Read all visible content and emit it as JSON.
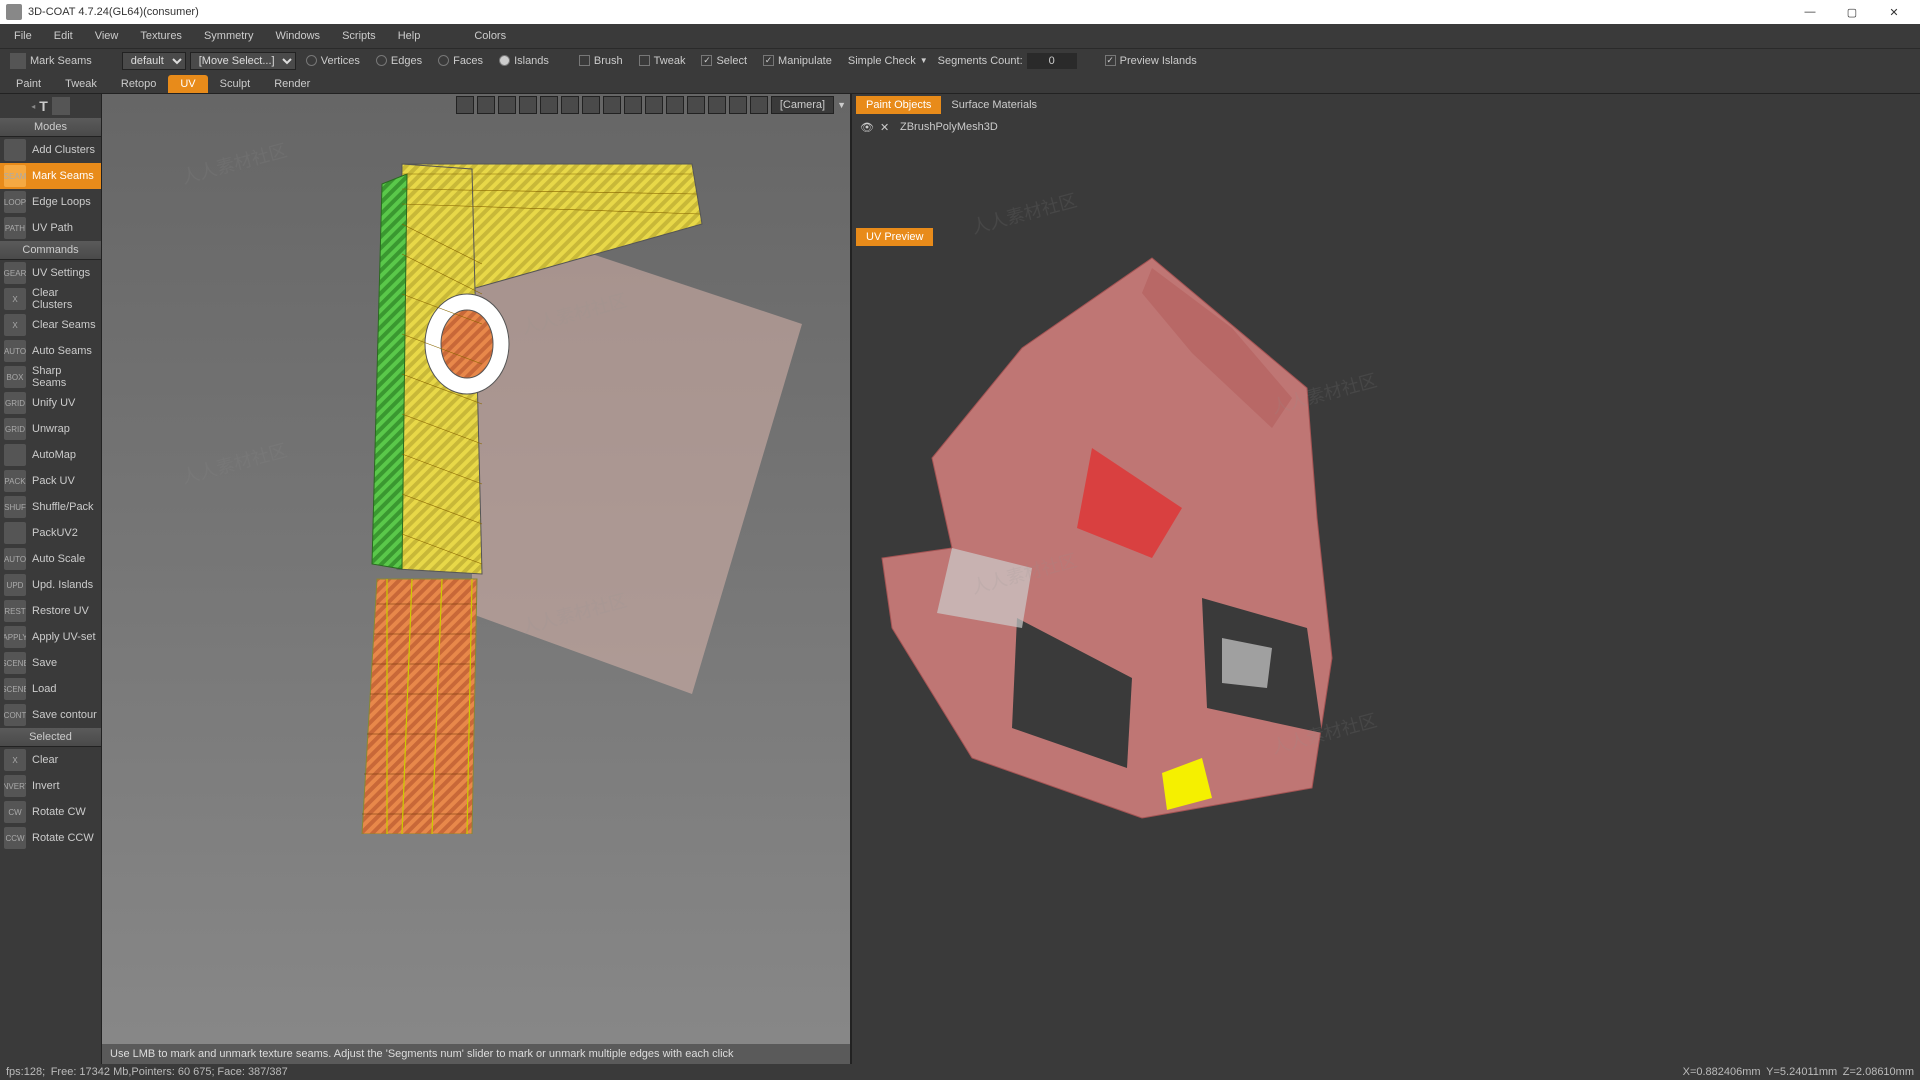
{
  "title": "3D-COAT 4.7.24(GL64)(consumer)",
  "mainmenu": [
    "File",
    "Edit",
    "View",
    "Textures",
    "Symmetry",
    "Windows",
    "Scripts",
    "Help",
    "Colors"
  ],
  "options": {
    "mark_seams": "Mark Seams",
    "preset_label": "default",
    "move_select": "[Move Select...]",
    "el_vertices": "Vertices",
    "el_edges": "Edges",
    "el_faces": "Faces",
    "el_islands": "Islands",
    "brush": "Brush",
    "tweak": "Tweak",
    "select": "Select",
    "manipulate": "Manipulate",
    "simple_check": "Simple Check",
    "segments_label": "Segments Count:",
    "segments_value": "0",
    "preview_islands": "Preview Islands"
  },
  "tabs": [
    "Paint",
    "Tweak",
    "Retopo",
    "UV",
    "Sculpt",
    "Render"
  ],
  "active_tab": "UV",
  "sidebar": {
    "modes_hdr": "Modes",
    "modes": [
      {
        "label": "Add Clusters",
        "ic": "cluster"
      },
      {
        "label": "Mark Seams",
        "ic": "seam",
        "active": true
      },
      {
        "label": "Edge Loops",
        "ic": "loop"
      },
      {
        "label": "UV Path",
        "ic": "path"
      }
    ],
    "commands_hdr": "Commands",
    "commands": [
      {
        "label": "UV Settings",
        "ic": "gear"
      },
      {
        "label": "Clear Clusters",
        "ic": "x"
      },
      {
        "label": "Clear Seams",
        "ic": "x"
      },
      {
        "label": "Auto Seams",
        "ic": "AUTO"
      },
      {
        "label": "Sharp Seams",
        "ic": "box"
      },
      {
        "label": "Unify UV",
        "ic": "grid"
      },
      {
        "label": "Unwrap",
        "ic": "grid"
      },
      {
        "label": "AutoMap",
        "ic": "AUTO MAP"
      },
      {
        "label": "Pack UV",
        "ic": "pack"
      },
      {
        "label": "Shuffle/Pack",
        "ic": "shuf"
      },
      {
        "label": "PackUV2",
        "ic": "pk2"
      },
      {
        "label": "Auto Scale",
        "ic": "AUTO"
      },
      {
        "label": "Upd. Islands",
        "ic": "upd"
      },
      {
        "label": "Restore UV",
        "ic": "rest"
      },
      {
        "label": "Apply UV-set",
        "ic": "apply"
      },
      {
        "label": "Save",
        "ic": "SCENE"
      },
      {
        "label": "Load",
        "ic": "SCENE"
      },
      {
        "label": "Save contour",
        "ic": "cont"
      }
    ],
    "selected_hdr": "Selected",
    "selected": [
      {
        "label": "Clear",
        "ic": "x"
      },
      {
        "label": "Invert",
        "ic": "INVERT"
      },
      {
        "label": "Rotate CW",
        "ic": "cw"
      },
      {
        "label": "Rotate CCW",
        "ic": "ccw"
      }
    ]
  },
  "viewport": {
    "camera_label": "[Camera]",
    "hint": "Use LMB to mark and unmark texture seams. Adjust the 'Segments num' slider to mark or unmark multiple edges with each click"
  },
  "rightpanel": {
    "tabs": [
      "Paint Objects",
      "Surface Materials"
    ],
    "active": "Paint Objects",
    "object_name": "ZBrushPolyMesh3D",
    "uv_preview": "UV Preview"
  },
  "statusbar": {
    "fps": "fps:128;",
    "free": "Free: 17342 Mb,",
    "pointers": "Pointers: 60 675;",
    "face": "Face: 387/387",
    "coords_x": "X=0.882406mm",
    "coords_y": "Y=5.24011mm",
    "coords_z": "Z=2.08610mm"
  }
}
